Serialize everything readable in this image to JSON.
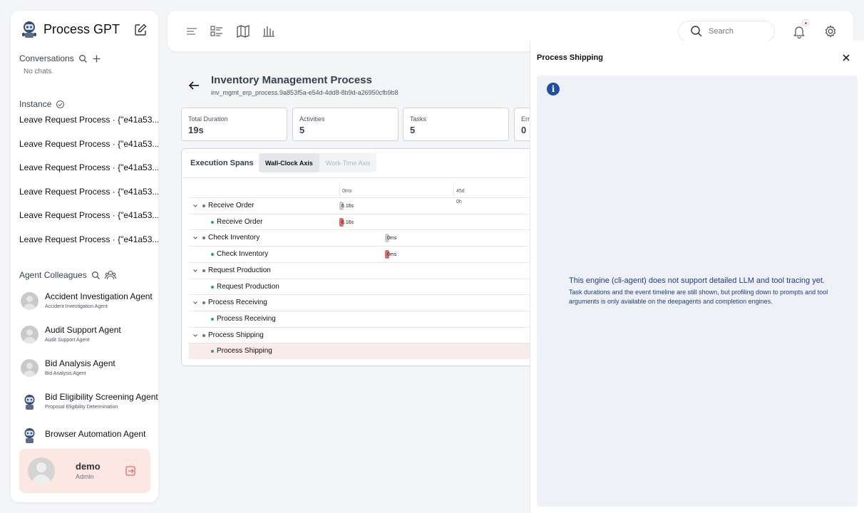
{
  "brand": {
    "title": "Process GPT"
  },
  "sidebar": {
    "conversations_label": "Conversations",
    "no_chats": "No chats.",
    "instance_label": "Instance",
    "instances": [
      "Leave Request Process · {\"e41a53...",
      "Leave Request Process · {\"e41a53...",
      "Leave Request Process · {\"e41a53...",
      "Leave Request Process · {\"e41a53...",
      "Leave Request Process · {\"e41a53...",
      "Leave Request Process · {\"e41a53..."
    ],
    "agents_label": "Agent Colleagues",
    "agents": [
      {
        "name": "Accident Investigation Agent",
        "sub": "Accident Investigation Agent",
        "icon": "person-avatar"
      },
      {
        "name": "Audit Support Agent",
        "sub": "Audit Support Agent",
        "icon": "person-avatar"
      },
      {
        "name": "Bid Analysis Agent",
        "sub": "Bid Analysis Agent",
        "icon": "person-avatar"
      },
      {
        "name": "Bid Eligibility Screening Agent",
        "sub": "Proposal Eligibility Determination",
        "icon": "robot-avatar"
      },
      {
        "name": "Browser Automation Agent",
        "sub": "",
        "icon": "robot-avatar"
      }
    ]
  },
  "user": {
    "name": "demo",
    "role": "Admin"
  },
  "topbar": {
    "search_placeholder": "Search"
  },
  "process": {
    "title": "Inventory Management Process",
    "id": "inv_mgmt_erp_process.9a853f5a-e54d-4dd8-8b9d-a26950cfb9b8",
    "stats": [
      {
        "label": "Total Duration",
        "value": "19s"
      },
      {
        "label": "Activities",
        "value": "5"
      },
      {
        "label": "Tasks",
        "value": "5"
      },
      {
        "label": "Err",
        "value": "0"
      }
    ]
  },
  "spans": {
    "title": "Execution Spans",
    "axis_wall": "Wall-Clock Axis",
    "axis_work": "Work-Time Axis",
    "ticks": [
      {
        "top": "0ms",
        "bottom": ""
      },
      {
        "top": "45d",
        "bottom": "0h"
      }
    ],
    "rows": [
      {
        "label": "Receive Order",
        "level": 0,
        "duration": "6.16s",
        "bar_color": "#c9ccd1",
        "bar_start_fraction": 0.0
      },
      {
        "label": "Receive Order",
        "level": 1,
        "duration": "6.16s",
        "bar_color": "#e06b66",
        "bar_start_fraction": 0.0
      },
      {
        "label": "Check Inventory",
        "level": 0,
        "duration": "0ms",
        "bar_color": "#c9ccd1",
        "bar_start_fraction": 0.4
      },
      {
        "label": "Check Inventory",
        "level": 1,
        "duration": "0ms",
        "bar_color": "#e06b66",
        "bar_start_fraction": 0.4
      },
      {
        "label": "Request Production",
        "level": 0,
        "duration": "",
        "bar_color": "",
        "bar_start_fraction": null
      },
      {
        "label": "Request Production",
        "level": 1,
        "duration": "",
        "bar_color": "",
        "bar_start_fraction": null
      },
      {
        "label": "Process Receiving",
        "level": 0,
        "duration": "",
        "bar_color": "",
        "bar_start_fraction": null
      },
      {
        "label": "Process Receiving",
        "level": 1,
        "duration": "",
        "bar_color": "",
        "bar_start_fraction": null
      },
      {
        "label": "Process Shipping",
        "level": 0,
        "duration": "",
        "bar_color": "",
        "bar_start_fraction": null
      },
      {
        "label": "Process Shipping",
        "level": 1,
        "duration": "",
        "bar_color": "",
        "bar_start_fraction": null,
        "selected": true
      }
    ]
  },
  "detail": {
    "title": "Process Shipping",
    "info_heading": "This engine (cli-agent) does not support detailed LLM and tool tracing yet.",
    "info_body": "Task durations and the event timeline are still shown, but profiling down to prompts and tool arguments is only available on the deepagents and completion engines."
  },
  "colors": {
    "accent_dot": "#2f9e7a",
    "selected_row": "#f9ebe9",
    "info_text": "#1f3a8a",
    "user_card": "#fde7e3"
  }
}
